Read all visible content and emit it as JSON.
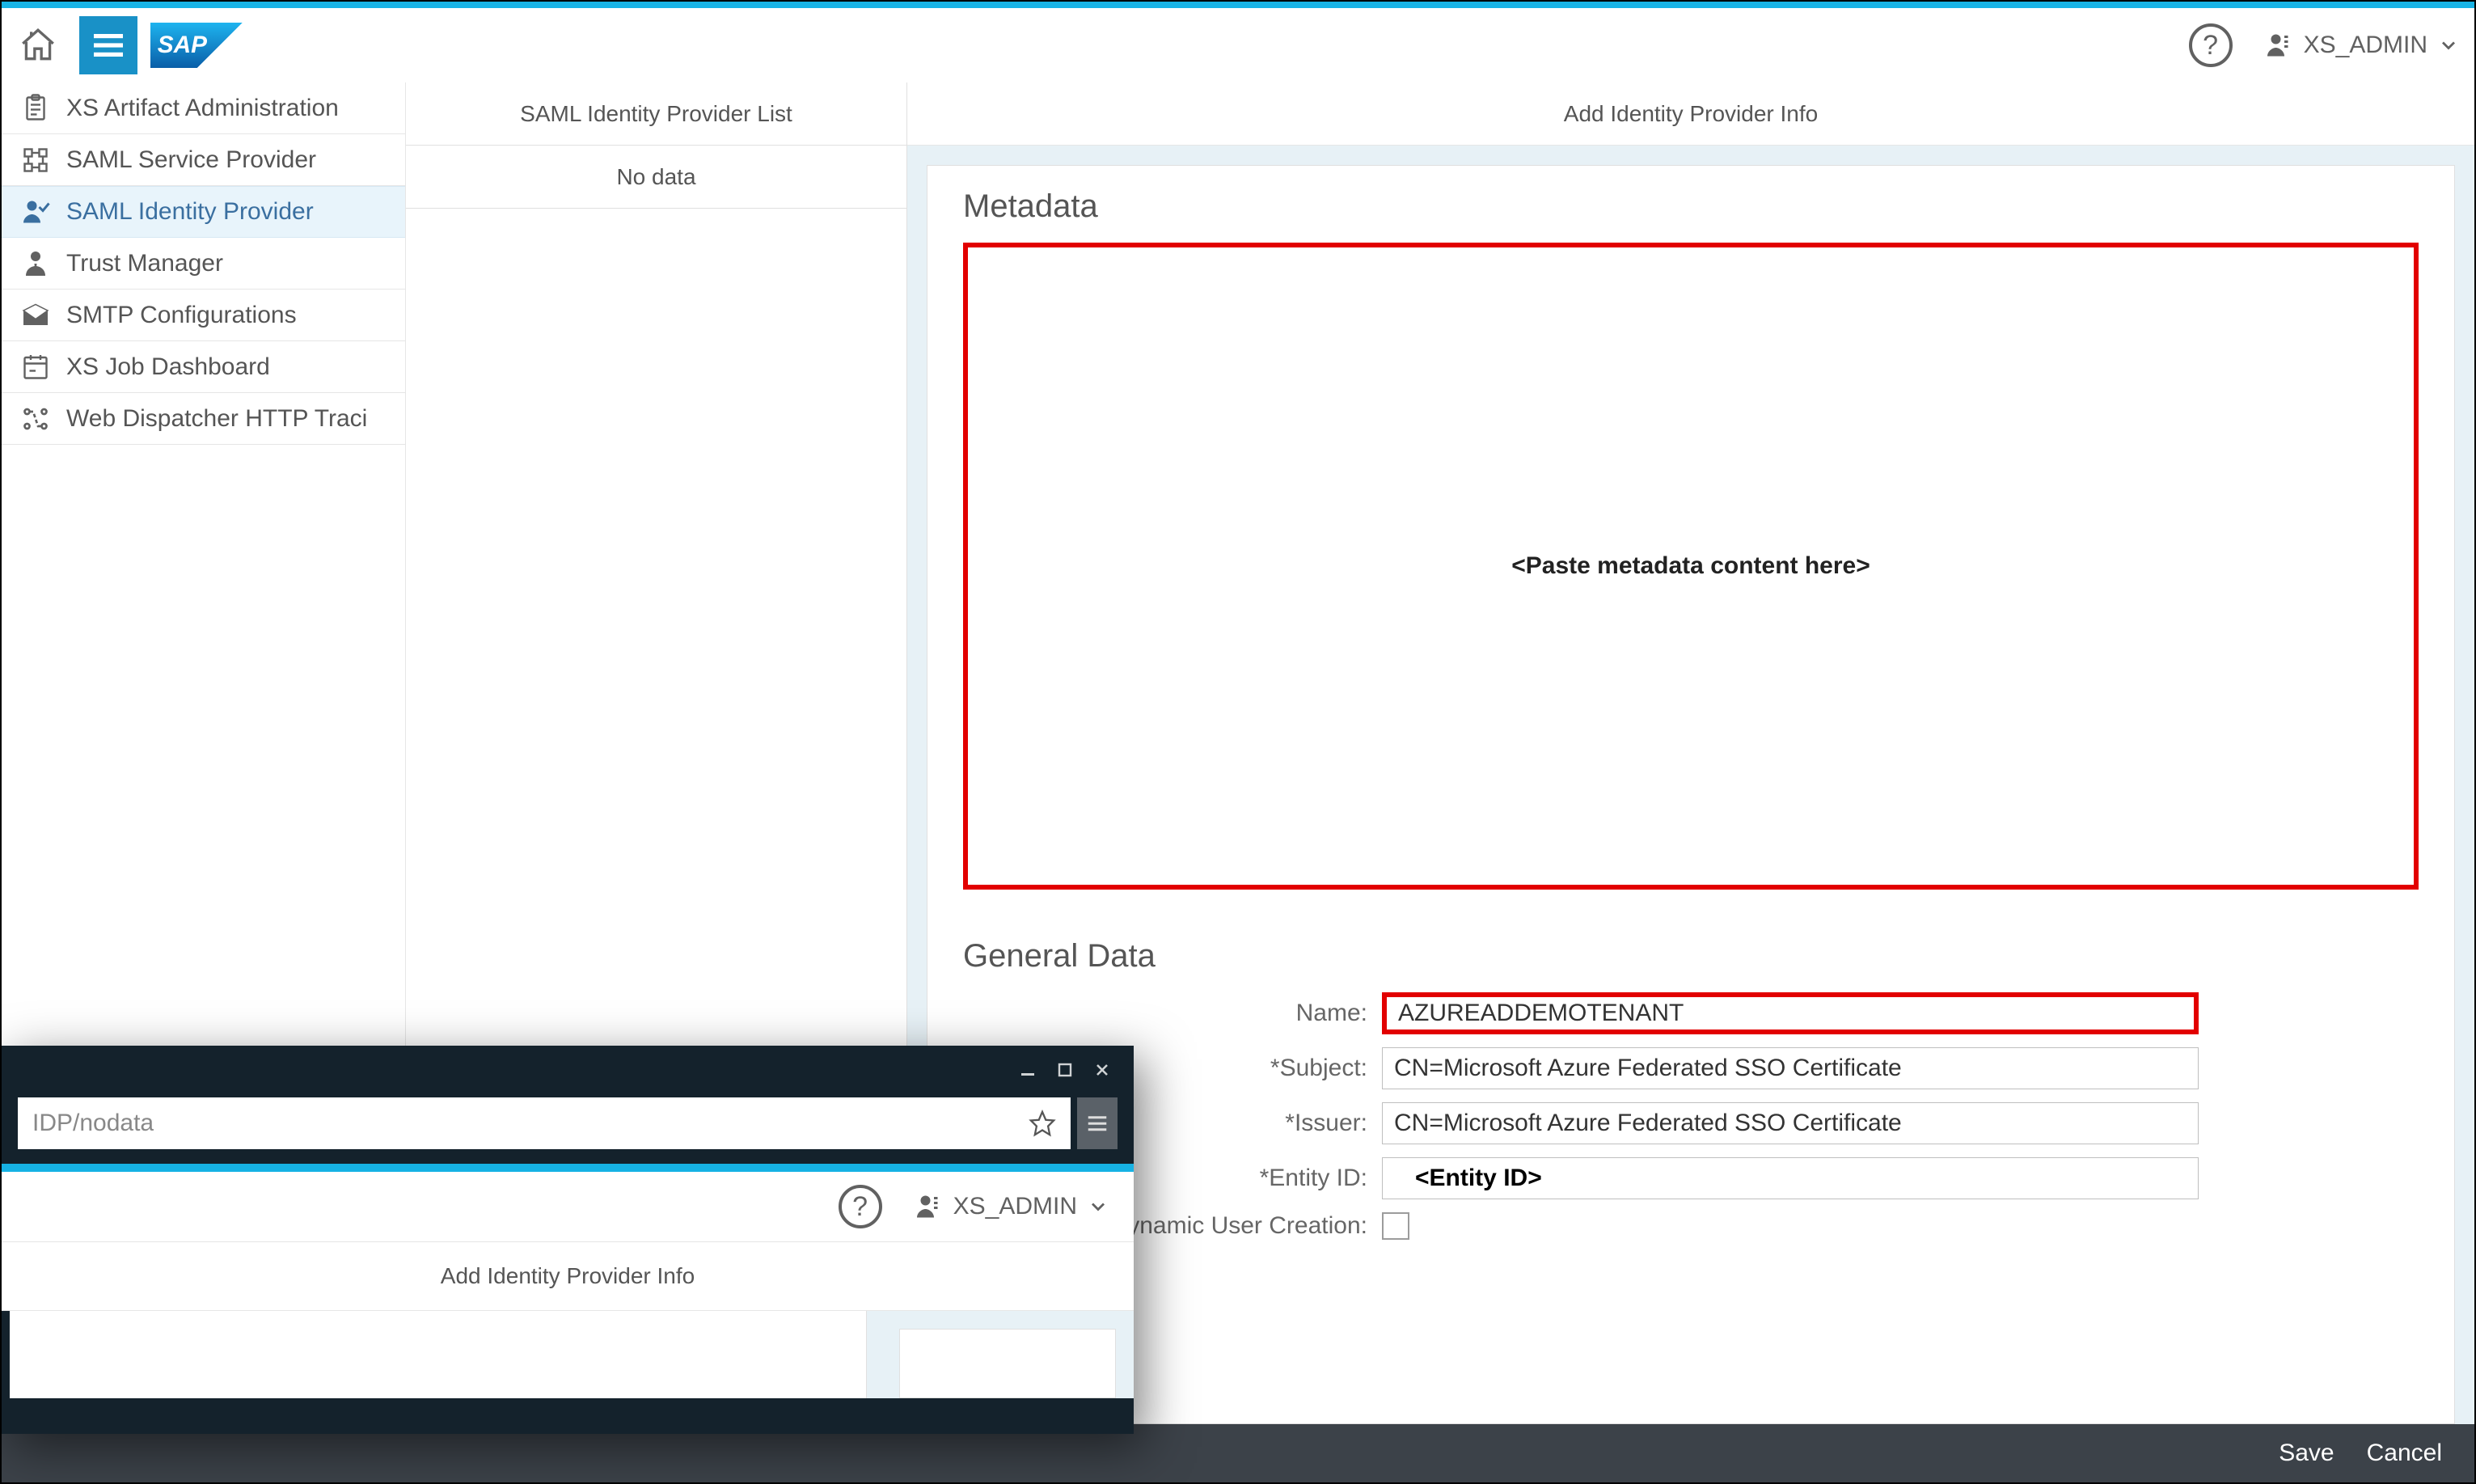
{
  "topbar": {
    "user": "XS_ADMIN"
  },
  "sidebar": {
    "items": [
      {
        "label": "XS Artifact Administration"
      },
      {
        "label": "SAML Service Provider"
      },
      {
        "label": "SAML Identity Provider"
      },
      {
        "label": "Trust Manager"
      },
      {
        "label": "SMTP Configurations"
      },
      {
        "label": "XS Job Dashboard"
      },
      {
        "label": "Web Dispatcher HTTP Traci"
      }
    ]
  },
  "midcol": {
    "title": "SAML Identity Provider List",
    "empty": "No data"
  },
  "content": {
    "header": "Add Identity Provider Info",
    "metadata_title": "Metadata",
    "metadata_placeholder": "<Paste metadata content here>",
    "general_title": "General Data",
    "form": {
      "name_label": "Name:",
      "name_value": "AZUREADDEMOTENANT",
      "subject_label": "Subject:",
      "subject_value": "CN=Microsoft Azure Federated SSO Certificate",
      "issuer_label": "Issuer:",
      "issuer_value": "CN=Microsoft Azure Federated SSO Certificate",
      "entity_label": "Entity ID:",
      "entity_value": "<Entity ID>",
      "dyn_label": "Dynamic User Creation:"
    }
  },
  "footer": {
    "save": "Save",
    "cancel": "Cancel"
  },
  "overlay": {
    "addr": "IDP/nodata",
    "user": "XS_ADMIN",
    "header": "Add Identity Provider Info"
  }
}
